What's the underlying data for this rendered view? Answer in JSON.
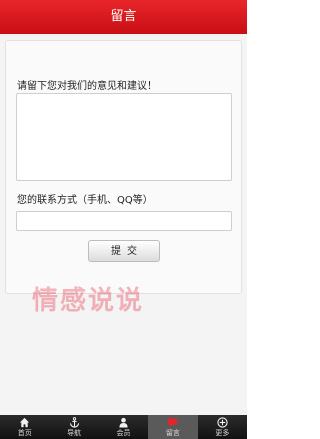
{
  "header": {
    "title": "留言"
  },
  "form": {
    "message_label": "请留下您对我们的意见和建议！",
    "message_value": "",
    "contact_label": "您的联系方式（手机、QQ等）",
    "contact_value": "",
    "submit_label": "提交"
  },
  "watermark": {
    "text": "情感说说"
  },
  "tabbar": {
    "items": [
      {
        "label": "首页",
        "icon": "home-icon"
      },
      {
        "label": "导航",
        "icon": "anchor-icon"
      },
      {
        "label": "会员",
        "icon": "user-icon"
      },
      {
        "label": "留言",
        "icon": "chat-icon",
        "active": true
      },
      {
        "label": "更多",
        "icon": "plus-circle-icon"
      }
    ]
  },
  "colors": {
    "accent": "#d8161b",
    "tabbar": "#1c1c1c"
  }
}
